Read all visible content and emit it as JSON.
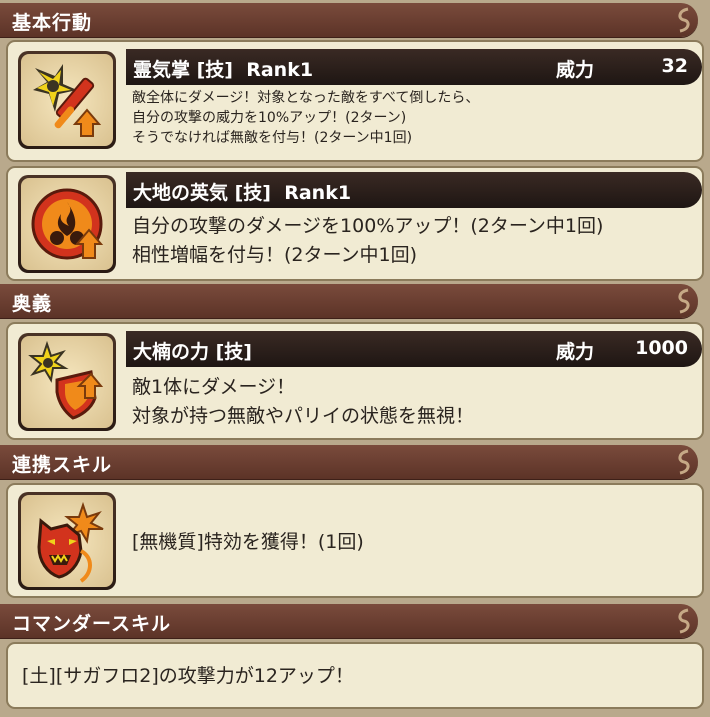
{
  "sections": {
    "basic": "基本行動",
    "ougi": "奥義",
    "renkei": "連携スキル",
    "commander": "コマンダースキル"
  },
  "skills": [
    {
      "name": "霊気掌 [技]",
      "rank": "Rank1",
      "power_label": "威力",
      "power_value": "32",
      "icon": "shuriken-sword-icon",
      "desc": [
        "敵全体にダメージ！対象となった敵をすべて倒したら、",
        "自分の攻撃の威力を10%アップ！(2ターン)",
        "そうでなければ無敵を付与！(2ターン中1回)"
      ]
    },
    {
      "name": "大地の英気 [技]",
      "rank": "Rank1",
      "icon": "fire-aura-icon",
      "desc": [
        "自分の攻撃のダメージを100%アップ！(2ターン中1回)",
        "相性増幅を付与！(2ターン中1回)"
      ]
    },
    {
      "name": "大楠の力 [技]",
      "power_label": "威力",
      "power_value": "1000",
      "icon": "burst-shield-icon",
      "desc": [
        "敵1体にダメージ！",
        "対象が持つ無敵やパリイの状態を無視！"
      ]
    },
    {
      "icon": "demon-mask-icon",
      "desc": [
        "[無機質]特効を獲得！(1回)"
      ]
    }
  ],
  "commander": {
    "text": "[土][サガフロ2]の攻撃力が12アップ！"
  },
  "colors": {
    "header": "#6b3f32",
    "panel": "#f1ebd3",
    "skill_bar": "#2a1e19",
    "icon_red": "#d2331d",
    "icon_yellow": "#f0d21a"
  }
}
